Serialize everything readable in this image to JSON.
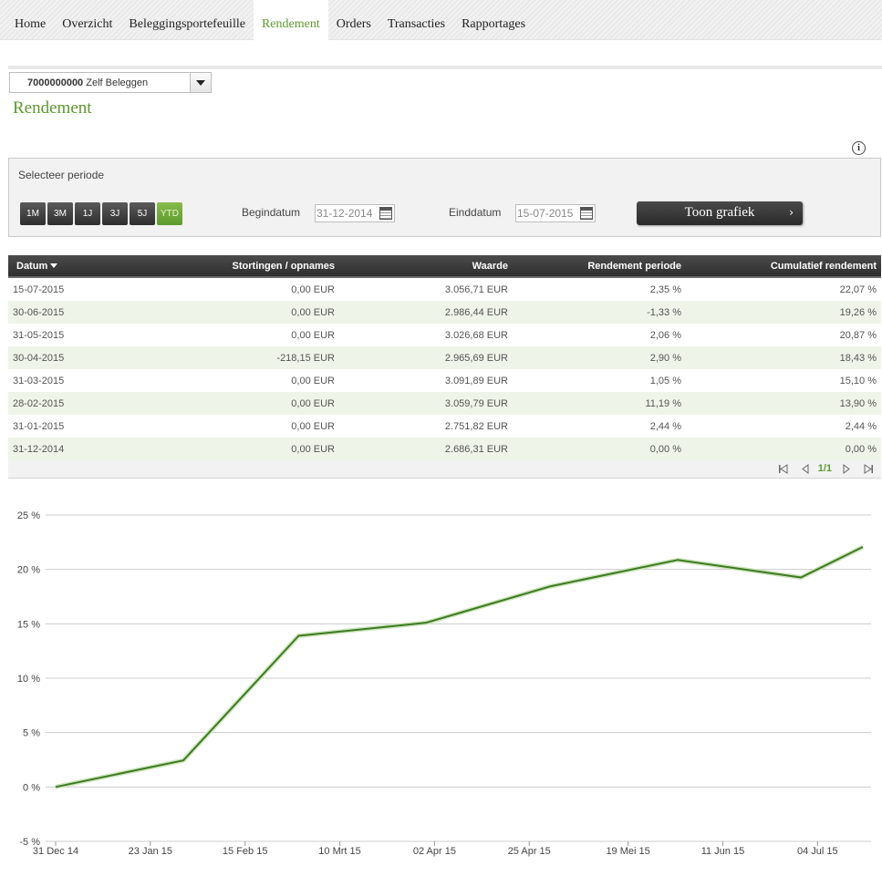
{
  "nav": {
    "items": [
      "Home",
      "Overzicht",
      "Beleggingsportefeuille",
      "Rendement",
      "Orders",
      "Transacties",
      "Rapportages"
    ],
    "active": "Rendement"
  },
  "account": {
    "number": "7000000000",
    "name": "Zelf Beleggen"
  },
  "page_title": "Rendement",
  "period": {
    "label": "Selecteer periode",
    "buttons": [
      "1M",
      "3M",
      "1J",
      "3J",
      "5J",
      "YTD"
    ],
    "active_button": "YTD",
    "begin_label": "Begindatum",
    "begin_value": "31-12-2014",
    "end_label": "Einddatum",
    "end_value": "15-07-2015",
    "show_chart_label": "Toon grafiek"
  },
  "table": {
    "headers": [
      "Datum",
      "Stortingen / opnames",
      "Waarde",
      "Rendement periode",
      "Cumulatief rendement"
    ],
    "rows": [
      [
        "15-07-2015",
        "0,00 EUR",
        "3.056,71 EUR",
        "2,35 %",
        "22,07 %"
      ],
      [
        "30-06-2015",
        "0,00 EUR",
        "2.986,44 EUR",
        "-1,33 %",
        "19,26 %"
      ],
      [
        "31-05-2015",
        "0,00 EUR",
        "3.026,68 EUR",
        "2,06 %",
        "20,87 %"
      ],
      [
        "30-04-2015",
        "-218,15 EUR",
        "2.965,69 EUR",
        "2,90 %",
        "18,43 %"
      ],
      [
        "31-03-2015",
        "0,00 EUR",
        "3.091,89 EUR",
        "1,05 %",
        "15,10 %"
      ],
      [
        "28-02-2015",
        "0,00 EUR",
        "3.059,79 EUR",
        "11,19 %",
        "13,90 %"
      ],
      [
        "31-01-2015",
        "0,00 EUR",
        "2.751,82 EUR",
        "2,44 %",
        "2,44 %"
      ],
      [
        "31-12-2014",
        "0,00 EUR",
        "2.686,31 EUR",
        "0,00 %",
        "0,00 %"
      ]
    ],
    "pager": "1/1"
  },
  "colors": {
    "accent": "#5c9a2e",
    "line": "#3b7d1e",
    "header": "#3a3a3a",
    "row_alt": "#eef4e8"
  },
  "chart_data": {
    "type": "line",
    "title": "",
    "xlabel": "",
    "ylabel": "",
    "ylim": [
      -5,
      25
    ],
    "y_ticks": [
      25,
      20,
      15,
      10,
      5,
      0,
      -5
    ],
    "y_tick_labels": [
      "25 %",
      "20 %",
      "15 %",
      "10 %",
      "5 %",
      "0 %",
      "-5 %"
    ],
    "x_ticks": [
      "2014-12-31",
      "2015-01-23",
      "2015-02-15",
      "2015-03-10",
      "2015-04-02",
      "2015-04-25",
      "2015-05-19",
      "2015-06-11",
      "2015-07-04"
    ],
    "x_tick_labels": [
      "31 Dec 14",
      "23 Jan 15",
      "15 Feb 15",
      "10 Mrt 15",
      "02 Apr 15",
      "25 Apr 15",
      "19 Mei 15",
      "11 Jun 15",
      "04 Jul 15"
    ],
    "grid": true,
    "series": [
      {
        "x": [
          "2014-12-31",
          "2015-01-31",
          "2015-02-28",
          "2015-03-31",
          "2015-04-30",
          "2015-05-31",
          "2015-06-30",
          "2015-07-15"
        ],
        "values": [
          0.0,
          2.44,
          13.9,
          15.1,
          18.43,
          20.87,
          19.26,
          22.07
        ]
      }
    ]
  }
}
